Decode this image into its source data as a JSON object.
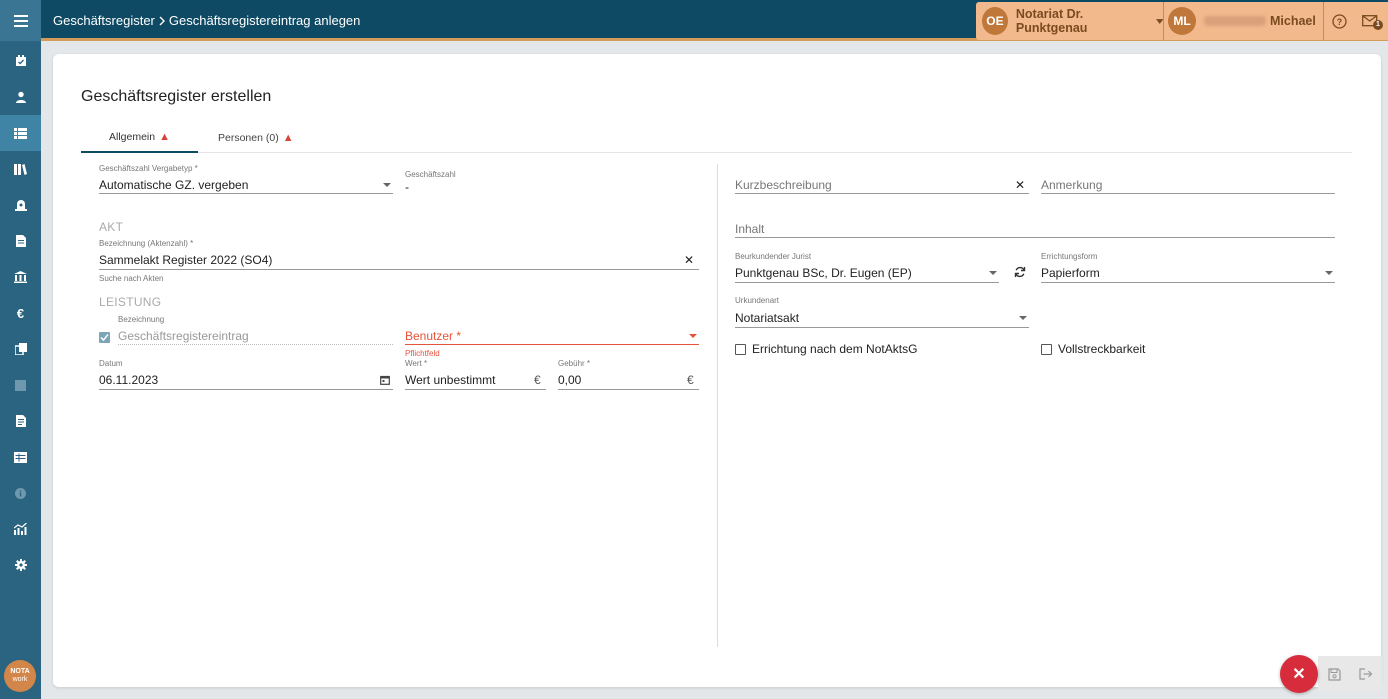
{
  "breadcrumb": {
    "root": "Geschäftsregister",
    "current": "Geschäftsregistereintrag anlegen"
  },
  "header": {
    "org_initials": "OE",
    "org_name": "Notariat Dr. Punktgenau",
    "user_initials": "ML",
    "user_first_name": "Michael",
    "notification_count": "1"
  },
  "sidebar": {
    "logo_line1": "NOTA",
    "logo_line2": "work",
    "items": [
      {
        "icon": "calendar-check-icon"
      },
      {
        "icon": "person-icon"
      },
      {
        "icon": "list-icon"
      },
      {
        "icon": "library-icon"
      },
      {
        "icon": "safe-icon"
      },
      {
        "icon": "document-icon"
      },
      {
        "icon": "bank-icon"
      },
      {
        "icon": "euro-icon"
      },
      {
        "icon": "copy-icon"
      },
      {
        "icon": "stop-icon"
      },
      {
        "icon": "file-text-icon"
      },
      {
        "icon": "table-icon"
      },
      {
        "icon": "info-icon"
      },
      {
        "icon": "analytics-icon"
      },
      {
        "icon": "settings-icon"
      }
    ]
  },
  "page": {
    "title": "Geschäftsregister erstellen",
    "tabs": [
      {
        "label": "Allgemein"
      },
      {
        "label": "Personen (0)"
      }
    ]
  },
  "form": {
    "gz_type_label": "Geschäftszahl Vergabetyp *",
    "gz_type_value": "Automatische GZ. vergeben",
    "gz_label": "Geschäftszahl",
    "gz_value": "-",
    "akt_section": "AKT",
    "akt_label": "Bezeichnung (Aktenzahl) *",
    "akt_value": "Sammelakt Register 2022 (SO4)",
    "akt_hint": "Suche nach Akten",
    "leistung_section": "LEISTUNG",
    "leistung_label": "Bezeichnung",
    "leistung_value": "Geschäftsregistereintrag",
    "benutzer_placeholder": "Benutzer *",
    "benutzer_error": "Pflichtfeld",
    "datum_label": "Datum",
    "datum_value": "06.11.2023",
    "wert_label": "Wert *",
    "wert_value": "Wert unbestimmt",
    "gebuehr_label": "Gebühr *",
    "gebuehr_value": "0,00",
    "currency": "€",
    "kurz_placeholder": "Kurzbeschreibung",
    "anmerkung_placeholder": "Anmerkung",
    "inhalt_placeholder": "Inhalt",
    "jurist_label": "Beurkundender Jurist",
    "jurist_value": "Punktgenau BSc, Dr. Eugen (EP)",
    "errichtung_label": "Errichtungsform",
    "errichtung_value": "Papierform",
    "urkundenart_label": "Urkundenart",
    "urkundenart_value": "Notariatsakt",
    "notakts_label": "Errichtung nach dem NotAktsG",
    "vollstreck_label": "Vollstreckbarkeit"
  },
  "colors": {
    "sidebar": "#2a6480",
    "topbar": "#0e4a64",
    "accent": "#f2b98d",
    "error": "#e5533a",
    "fab": "#d62c3c"
  }
}
